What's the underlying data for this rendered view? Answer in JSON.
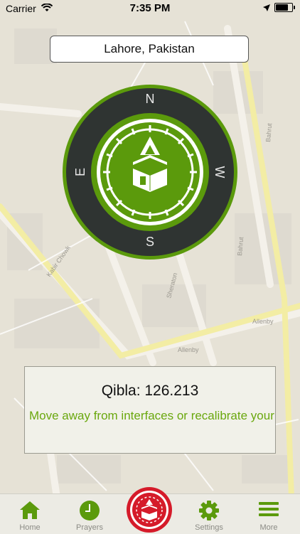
{
  "status_bar": {
    "carrier": "Carrier",
    "time": "7:35 PM"
  },
  "location": {
    "label": "Lahore, Pakistan"
  },
  "compass": {
    "north": "N",
    "south": "S",
    "east": "E",
    "west": "W"
  },
  "qibla": {
    "heading_text": "Qibla: 126.213",
    "message": "Move away from interfaces or recalibrate your device by moving it t..."
  },
  "tabs": [
    {
      "label": "Home",
      "icon": "home-icon"
    },
    {
      "label": "Prayers",
      "icon": "clock-icon"
    },
    {
      "label": "",
      "icon": "kaaba-icon"
    },
    {
      "label": "Settings",
      "icon": "gear-icon"
    },
    {
      "label": "More",
      "icon": "menu-icon"
    }
  ],
  "map_labels": [
    "Allenby",
    "Allenby",
    "Bahrut",
    "Bahrut",
    "Sheraton",
    "Kabir Chowk"
  ],
  "colors": {
    "accent": "#6aa80e",
    "dark_ring": "#2f3432",
    "tab_center": "#d51b2a"
  }
}
